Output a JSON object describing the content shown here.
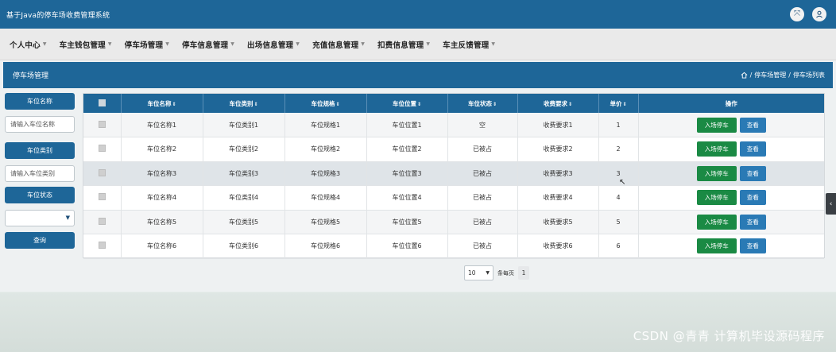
{
  "app": {
    "title": "基于Java的停车场收费管理系统"
  },
  "header_icons": [
    "expand-icon",
    "user-icon"
  ],
  "menu": [
    {
      "label": "个人中心"
    },
    {
      "label": "车主钱包管理"
    },
    {
      "label": "停车场管理"
    },
    {
      "label": "停车信息管理"
    },
    {
      "label": "出场信息管理"
    },
    {
      "label": "充值信息管理"
    },
    {
      "label": "扣费信息管理"
    },
    {
      "label": "车主反馈管理"
    }
  ],
  "page": {
    "title": "停车场管理",
    "breadcrumb": [
      "停车场管理",
      "停车场列表"
    ],
    "breadcrumb_sep": "/"
  },
  "search": {
    "name_label": "车位名称",
    "name_placeholder": "请输入车位名称",
    "type_label": "车位类别",
    "type_placeholder": "请输入车位类别",
    "status_label": "车位状态",
    "status_value": "",
    "query_label": "查询"
  },
  "table": {
    "columns": [
      "车位名称",
      "车位类别",
      "车位规格",
      "车位位置",
      "车位状态",
      "收费要求",
      "单价",
      "操作"
    ],
    "rows": [
      {
        "name": "车位名称1",
        "type": "车位类别1",
        "spec": "车位规格1",
        "location": "车位位置1",
        "status": "空",
        "fee": "收费要求1",
        "price": "1"
      },
      {
        "name": "车位名称2",
        "type": "车位类别2",
        "spec": "车位规格2",
        "location": "车位位置2",
        "status": "已被占",
        "fee": "收费要求2",
        "price": "2"
      },
      {
        "name": "车位名称3",
        "type": "车位类别3",
        "spec": "车位规格3",
        "location": "车位位置3",
        "status": "已被占",
        "fee": "收费要求3",
        "price": "3"
      },
      {
        "name": "车位名称4",
        "type": "车位类别4",
        "spec": "车位规格4",
        "location": "车位位置4",
        "status": "已被占",
        "fee": "收费要求4",
        "price": "4"
      },
      {
        "name": "车位名称5",
        "type": "车位类别5",
        "spec": "车位规格5",
        "location": "车位位置5",
        "status": "已被占",
        "fee": "收费要求5",
        "price": "5"
      },
      {
        "name": "车位名称6",
        "type": "车位类别6",
        "spec": "车位规格6",
        "location": "车位位置6",
        "status": "已被占",
        "fee": "收费要求6",
        "price": "6"
      }
    ],
    "enter_label": "入场停车",
    "view_label": "查看"
  },
  "pagination": {
    "page_size": "10",
    "per_page_text": "条每页",
    "current_page": "1"
  },
  "watermark": "CSDN @青青 计算机毕设源码程序",
  "colors": {
    "primary": "#1e6698",
    "green": "#1a8a44",
    "blue_button": "#2a7ab5"
  }
}
